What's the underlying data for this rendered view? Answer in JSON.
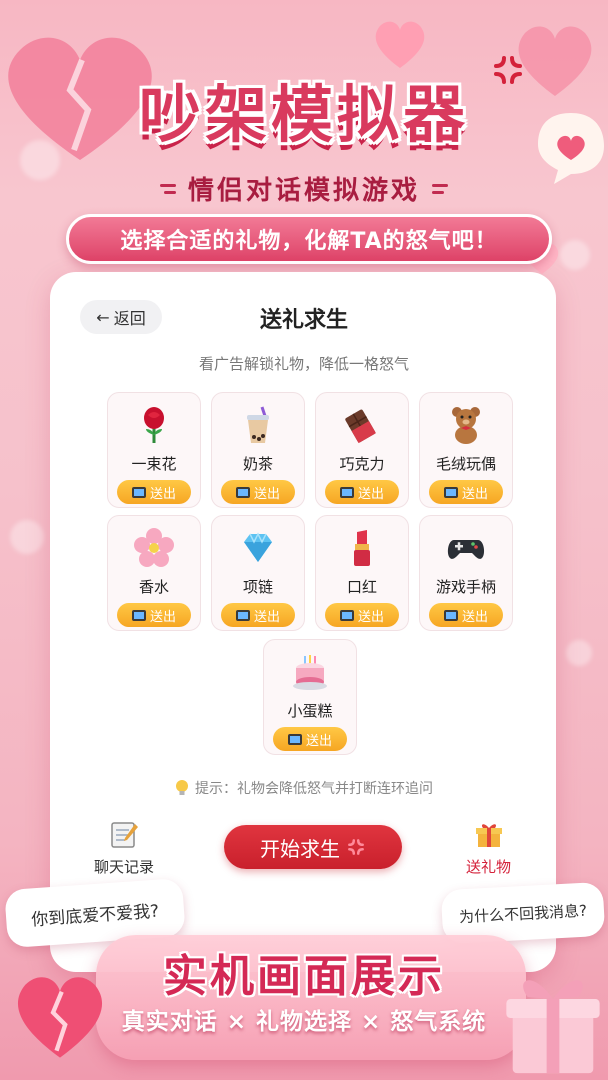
{
  "header": {
    "title": "吵架模拟器",
    "subtitle": "情侣对话模拟游戏",
    "banner": "选择合适的礼物，化解TA的怒气吧！"
  },
  "screen": {
    "back_label": "返回",
    "title": "送礼求生",
    "hint": "看广告解锁礼物，降低一格怒气",
    "send_label": "送出",
    "gifts": [
      {
        "name": "一束花",
        "icon": "rose-icon"
      },
      {
        "name": "奶茶",
        "icon": "bubble-tea-icon"
      },
      {
        "name": "巧克力",
        "icon": "chocolate-icon"
      },
      {
        "name": "毛绒玩偶",
        "icon": "teddy-bear-icon"
      },
      {
        "name": "香水",
        "icon": "cherry-blossom-icon"
      },
      {
        "name": "项链",
        "icon": "diamond-icon"
      },
      {
        "name": "口红",
        "icon": "lipstick-icon"
      },
      {
        "name": "游戏手柄",
        "icon": "gamepad-icon"
      },
      {
        "name": "小蛋糕",
        "icon": "cake-icon"
      }
    ],
    "tip": "提示：礼物会降低怒气并打断连环追问",
    "nav": {
      "chat_history": "聊天记录",
      "start_button": "开始求生",
      "send_gift": "送礼物"
    }
  },
  "bubbles": {
    "left": "你到底爱不爱我?",
    "right": "为什么不回我消息?"
  },
  "footer": {
    "title": "实机画面展示",
    "features": "真实对话 × 礼物选择 × 怒气系统"
  },
  "colors": {
    "accent": "#d93a5e",
    "start_button": "#d22a35",
    "send_button": "#f6a623",
    "gift_nav": "#d4213a"
  }
}
